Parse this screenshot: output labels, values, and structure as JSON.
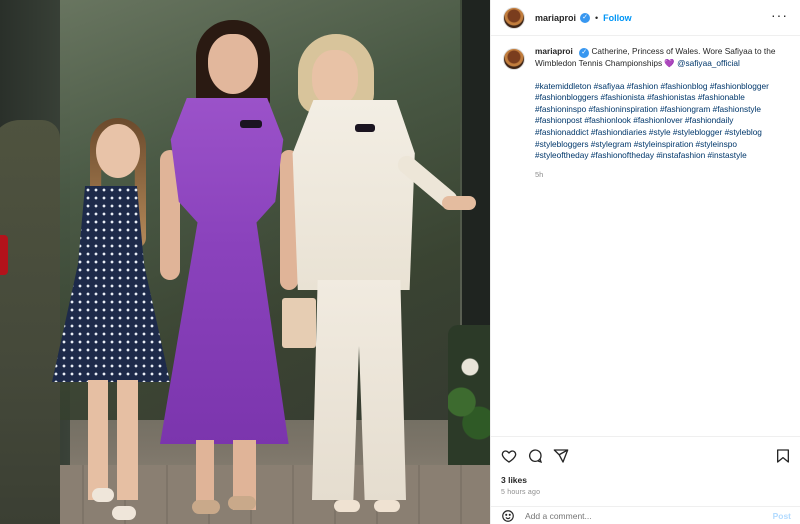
{
  "post": {
    "username": "mariaproi",
    "verified_badge": "✓",
    "separator": "•",
    "follow_label": "Follow",
    "more_label": "···",
    "caption_user": "mariaproi",
    "caption_text": "Catherine, Princess of Wales. Wore Safiyaa to the Wimbledon Tennis Championships 💜",
    "caption_mention": "@safiyaa_official",
    "hashtags": "#katemiddleton #safiyaa #fashion #fashionblog #fashionblogger #fashionbloggers #fashionista #fashionistas #fashionable #fashioninspo #fashioninspiration #fashiongram #fashionstyle #fashionpost #fashionlook #fashionlover #fashiondaily #fashionaddict #fashiondiaries #style #styleblogger #styleblog #stylebloggers #stylegram #styleinspiration #styleinspo #styleoftheday #fashionoftheday #instafashion #instastyle",
    "caption_time": "5h",
    "likes": "3 likes",
    "posted_ago": "5 hours ago"
  },
  "comment": {
    "placeholder": "Add a comment...",
    "post_label": "Post"
  },
  "icons": {
    "like": "heart-icon",
    "comment": "comment-icon",
    "share": "share-icon",
    "save": "bookmark-icon",
    "emoji": "emoji-icon",
    "more": "more-icon"
  },
  "colors": {
    "link": "#00376b",
    "follow": "#0095f6",
    "verified": "#3897f0",
    "muted": "#8e8e8e"
  }
}
